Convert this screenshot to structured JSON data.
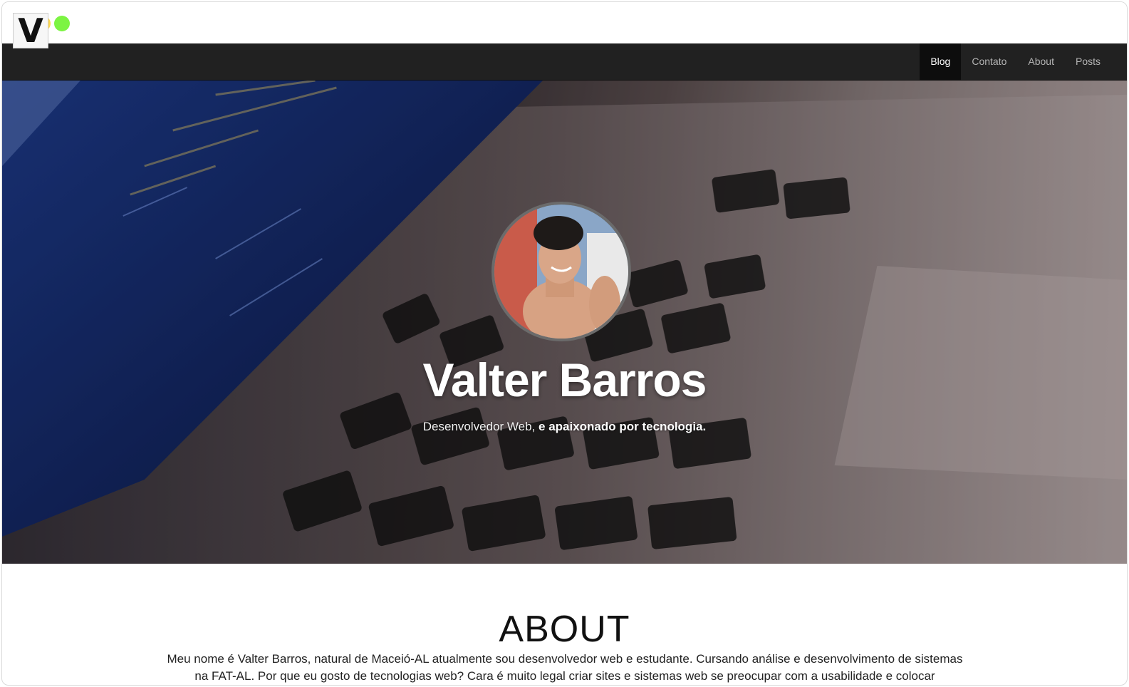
{
  "window": {
    "controls": [
      "close",
      "minimize",
      "maximize"
    ]
  },
  "navbar": {
    "brand": "V",
    "links": [
      {
        "label": "Blog",
        "active": true
      },
      {
        "label": "Contato",
        "active": false
      },
      {
        "label": "About",
        "active": false
      },
      {
        "label": "Posts",
        "active": false
      }
    ]
  },
  "hero": {
    "title": "Valter Barros",
    "subtitle_regular": "Desenvolvedor Web,",
    "subtitle_bold": "e apaixonado por tecnologia."
  },
  "about": {
    "title": "ABOUT",
    "text": "Meu nome é Valter Barros, natural de Maceió-AL atualmente sou desenvolvedor web e estudante. Cursando análise e desenvolvimento de sistemas na FAT-AL. Por que eu gosto de tecnologias web? Cara é muito legal criar sites e sistemas web se preocupar com a usabilidade e colocar"
  },
  "colors": {
    "navbar_bg": "#212121",
    "nav_active_bg": "#0d0d0d",
    "traffic_red": "#ff2a2a",
    "traffic_yellow": "#ffd84d",
    "traffic_green": "#7cf442"
  }
}
